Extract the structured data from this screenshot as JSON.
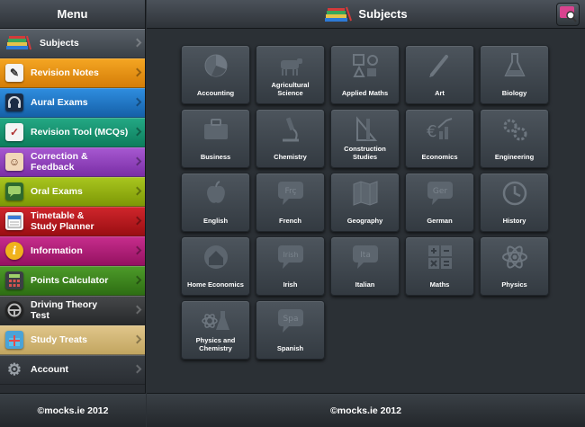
{
  "sidebar": {
    "title": "Menu",
    "footer": "©mocks.ie 2012",
    "items": [
      {
        "label": "Subjects",
        "icon": "books-icon"
      },
      {
        "label": "Revision Notes",
        "icon": "notepad-icon"
      },
      {
        "label": "Aural Exams",
        "icon": "headphones-icon"
      },
      {
        "label": "Revision Tool (MCQs)",
        "icon": "checklist-icon"
      },
      {
        "label": "Correction & Feedback",
        "icon": "teacher-icon"
      },
      {
        "label": "Oral Exams",
        "icon": "chat-icon"
      },
      {
        "label": "Timetable &\nStudy Planner",
        "icon": "calendar-icon"
      },
      {
        "label": "Information",
        "icon": "info-icon"
      },
      {
        "label": "Points Calculator",
        "icon": "calculator-icon"
      },
      {
        "label": "Driving Theory\nTest",
        "icon": "steering-wheel-icon"
      },
      {
        "label": "Study Treats",
        "icon": "gift-icon"
      },
      {
        "label": "Account",
        "icon": "gear-icon"
      }
    ]
  },
  "main": {
    "title": "Subjects",
    "footer": "©mocks.ie 2012",
    "subjects": [
      {
        "label": "Accounting",
        "icon": "pie-chart-icon"
      },
      {
        "label": "Agricultural\nScience",
        "icon": "cow-icon"
      },
      {
        "label": "Applied Maths",
        "icon": "shapes-icon"
      },
      {
        "label": "Art",
        "icon": "paintbrush-icon"
      },
      {
        "label": "Biology",
        "icon": "flask-icon"
      },
      {
        "label": "Business",
        "icon": "briefcase-icon"
      },
      {
        "label": "Chemistry",
        "icon": "microscope-icon"
      },
      {
        "label": "Construction\nStudies",
        "icon": "set-square-icon"
      },
      {
        "label": "Economics",
        "icon": "euro-chart-icon"
      },
      {
        "label": "Engineering",
        "icon": "gears-icon"
      },
      {
        "label": "English",
        "icon": "apple-icon"
      },
      {
        "label": "French",
        "icon": "speech-bubble-fr-icon",
        "badge": "Frç"
      },
      {
        "label": "Geography",
        "icon": "map-icon"
      },
      {
        "label": "German",
        "icon": "speech-bubble-ger-icon",
        "badge": "Ger"
      },
      {
        "label": "History",
        "icon": "clock-icon"
      },
      {
        "label": "Home Economics",
        "icon": "house-icon"
      },
      {
        "label": "Irish",
        "icon": "speech-bubble-irish-icon",
        "badge": "Irish"
      },
      {
        "label": "Italian",
        "icon": "speech-bubble-ita-icon",
        "badge": "Ita"
      },
      {
        "label": "Maths",
        "icon": "math-symbols-icon"
      },
      {
        "label": "Physics",
        "icon": "atom-icon"
      },
      {
        "label": "Physics and\nChemistry",
        "icon": "atom-flask-icon"
      },
      {
        "label": "Spanish",
        "icon": "speech-bubble-spa-icon",
        "badge": "Spa"
      }
    ]
  }
}
